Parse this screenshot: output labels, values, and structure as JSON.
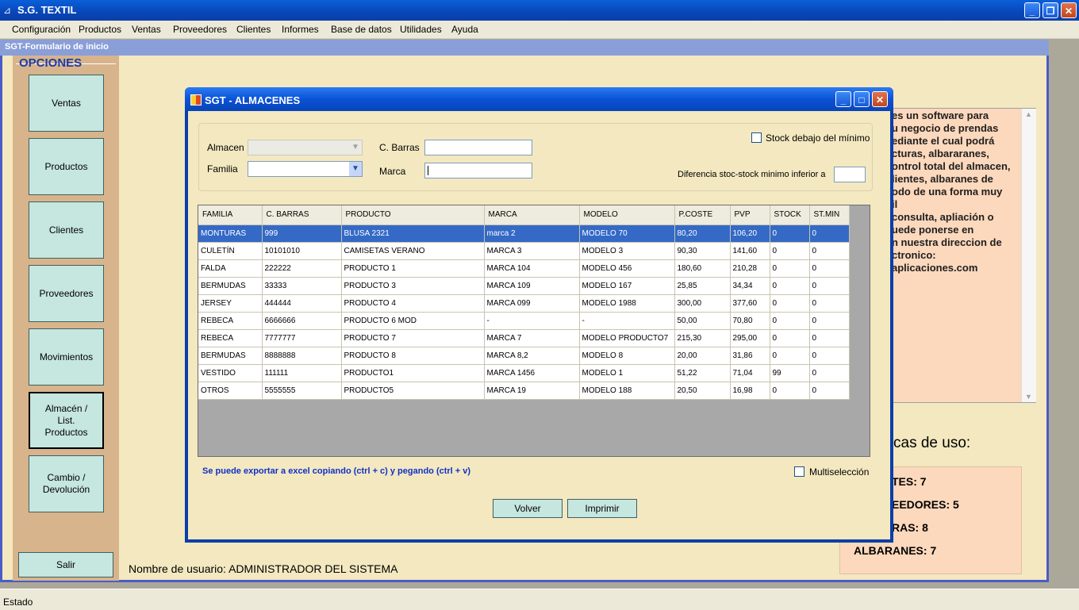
{
  "app": {
    "title": "S.G. TEXTIL"
  },
  "menu": [
    "Configuración",
    "Productos",
    "Ventas",
    "Proveedores",
    "Clientes",
    "Informes",
    "Base de datos",
    "Utilidades",
    "Ayuda"
  ],
  "form": {
    "title": "SGT-Formulario de inicio"
  },
  "options": {
    "header": "OPCIONES",
    "buttons": [
      "Ventas",
      "Productos",
      "Clientes",
      "Proveedores",
      "Movimientos",
      "Almacén / List. Productos",
      "Cambio / Devolución"
    ],
    "exit": "Salir"
  },
  "user": {
    "label": "Nombre de usuario: ADMINISTRADOR DEL SISTEMA"
  },
  "info": {
    "text": "es un software para\nu negocio de prendas\nediante el cual podrá\ncturas, albararanes,\nontrol total del almacen,\nlientes, albaranes de\nodo de una forma muy\nil\nconsulta, apliación o\nuede ponerse en\nn nuestra direccion de\nctronico:\naplicaciones.com"
  },
  "stats": {
    "title": "cas de uso:",
    "lines": [
      "TES: 7",
      "EEDORES: 5",
      "RAS: 8",
      "ALBARANES: 7"
    ]
  },
  "status": {
    "text": "Estado"
  },
  "dialog": {
    "title": "SGT - ALMACENES",
    "filters": {
      "almacen_label": "Almacen",
      "familia_label": "Familia",
      "barras_label": "C. Barras",
      "marca_label": "Marca",
      "stock_below_label": "Stock debajo del mínimo",
      "diff_label": "Diferencia stoc-stock minimo inferior a"
    },
    "grid": {
      "columns": [
        "FAMILIA",
        "C. BARRAS",
        "PRODUCTO",
        "MARCA",
        "MODELO",
        "P.COSTE",
        "PVP",
        "STOCK",
        "ST.MIN"
      ],
      "rows": [
        [
          "MONTURAS",
          "999",
          "BLUSA 2321",
          "marca 2",
          "MODELO 70",
          "80,20",
          "106,20",
          "0",
          "0"
        ],
        [
          "CULETÍN",
          "10101010",
          "CAMISETAS VERANO",
          "MARCA 3",
          "MODELO 3",
          "90,30",
          "141,60",
          "0",
          "0"
        ],
        [
          "FALDA",
          "222222",
          "PRODUCTO 1",
          "MARCA 104",
          "MODELO 456",
          "180,60",
          "210,28",
          "0",
          "0"
        ],
        [
          "BERMUDAS",
          "33333",
          "PRODUCTO 3",
          "MARCA 109",
          "MODELO 167",
          "25,85",
          "34,34",
          "0",
          "0"
        ],
        [
          "JERSEY",
          "444444",
          "PRODUCTO 4",
          "MARCA 099",
          "MODELO 1988",
          "300,00",
          "377,60",
          "0",
          "0"
        ],
        [
          "REBECA",
          "6666666",
          "PRODUCTO 6 MOD",
          "-",
          "-",
          "50,00",
          "70,80",
          "0",
          "0"
        ],
        [
          "REBECA",
          "7777777",
          "PRODUCTO 7",
          "MARCA 7",
          "MODELO PRODUCTO7",
          "215,30",
          "295,00",
          "0",
          "0"
        ],
        [
          "BERMUDAS",
          "8888888",
          "PRODUCTO 8",
          "MARCA 8,2",
          "MODELO 8",
          "20,00",
          "31,86",
          "0",
          "0"
        ],
        [
          "VESTIDO",
          "111111",
          "PRODUCTO1",
          "MARCA 1456",
          "MODELO 1",
          "51,22",
          "71,04",
          "99",
          "0"
        ],
        [
          "OTROS",
          "5555555",
          "PRODUCTO5",
          "MARCA 19",
          "MODELO 188",
          "20,50",
          "16,98",
          "0",
          "0"
        ]
      ]
    },
    "export_note": "Se puede exportar a excel copiando (ctrl + c) y pegando (ctrl + v)",
    "multiselect_label": "Multiselección",
    "back_button": "Volver",
    "print_button": "Imprimir"
  }
}
